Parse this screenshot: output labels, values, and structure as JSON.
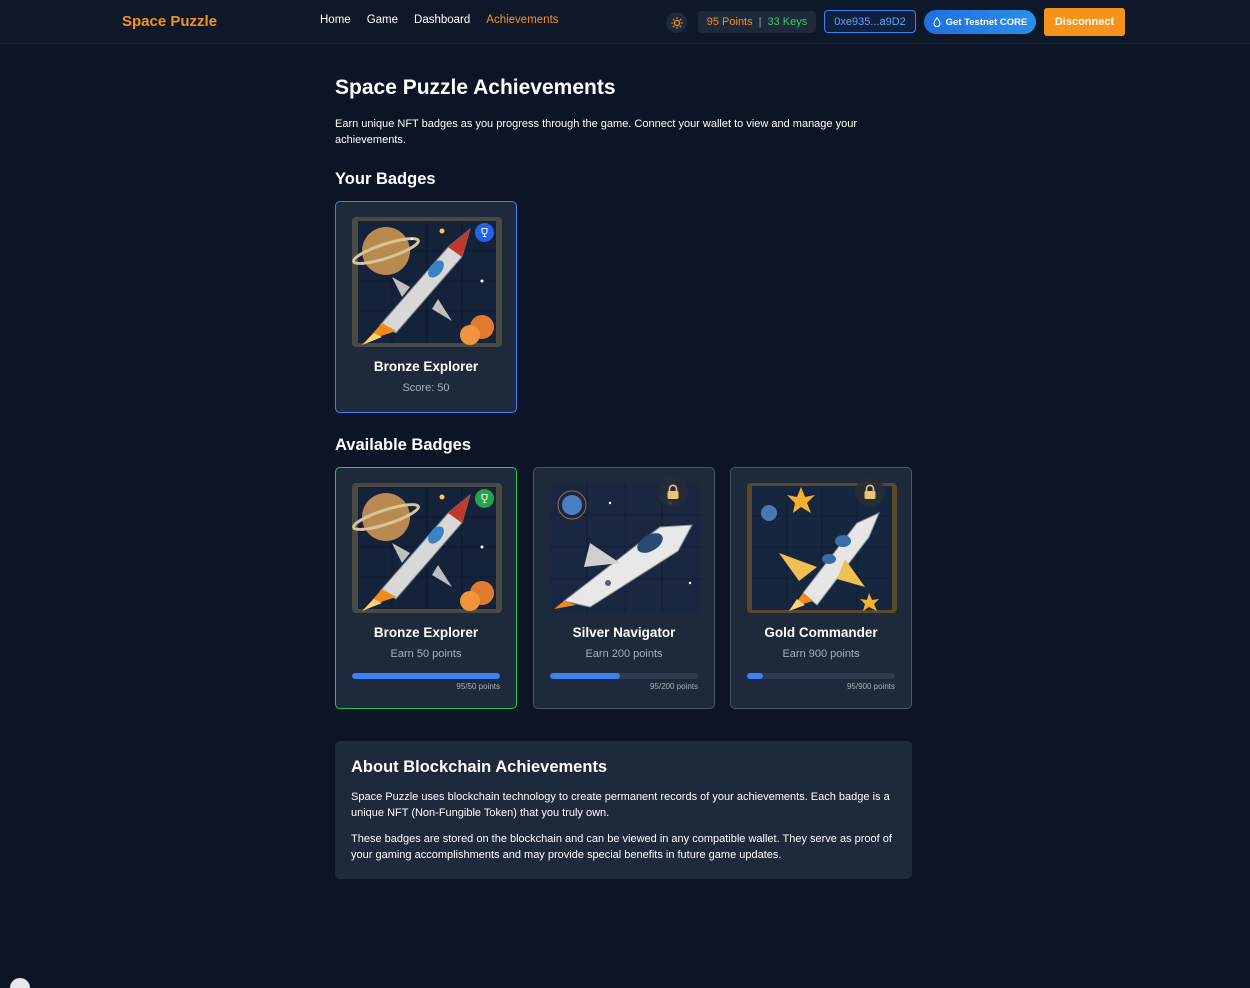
{
  "header": {
    "brand": "Space Puzzle",
    "nav": [
      "Home",
      "Game",
      "Dashboard",
      "Achievements"
    ],
    "active_nav": "Achievements",
    "points": "95 Points",
    "keys": "33 Keys",
    "wallet": "0xe935...a9D2",
    "faucet_label": "Get Testnet CORE",
    "disconnect_label": "Disconnect"
  },
  "page": {
    "title": "Space Puzzle Achievements",
    "intro": "Earn unique NFT badges as you progress through the game. Connect your wallet to view and manage your achievements."
  },
  "your_badges": {
    "title": "Your Badges",
    "items": [
      {
        "name": "Bronze Explorer",
        "detail": "Score: 50"
      }
    ]
  },
  "available_badges": {
    "title": "Available Badges",
    "items": [
      {
        "name": "Bronze Explorer",
        "requirement": "Earn 50 points",
        "progress_text": "95/50 points",
        "progress_fraction": 1.0,
        "status": "earned"
      },
      {
        "name": "Silver Navigator",
        "requirement": "Earn 200 points",
        "progress_text": "95/200 points",
        "progress_fraction": 0.475,
        "status": "locked"
      },
      {
        "name": "Gold Commander",
        "requirement": "Earn 900 points",
        "progress_text": "95/900 points",
        "progress_fraction": 0.106,
        "status": "locked"
      }
    ]
  },
  "about": {
    "title": "About Blockchain Achievements",
    "p1": "Space Puzzle uses blockchain technology to create permanent records of your achievements. Each badge is a unique NFT (Non-Fungible Token) that you truly own.",
    "p2": "These badges are stored on the blockchain and can be viewed in any compatible wallet. They serve as proof of your gaming accomplishments and may provide special benefits in future game updates."
  },
  "colors": {
    "accent": "#f5931a",
    "keys": "#33cc66",
    "progress": "#3b82f6",
    "owned_border": "#3b82f6",
    "earned_border": "#22c55e"
  },
  "icons": {
    "theme": "sun-icon",
    "faucet": "droplet-icon",
    "owned": "trophy-icon",
    "locked": "lock-icon"
  }
}
